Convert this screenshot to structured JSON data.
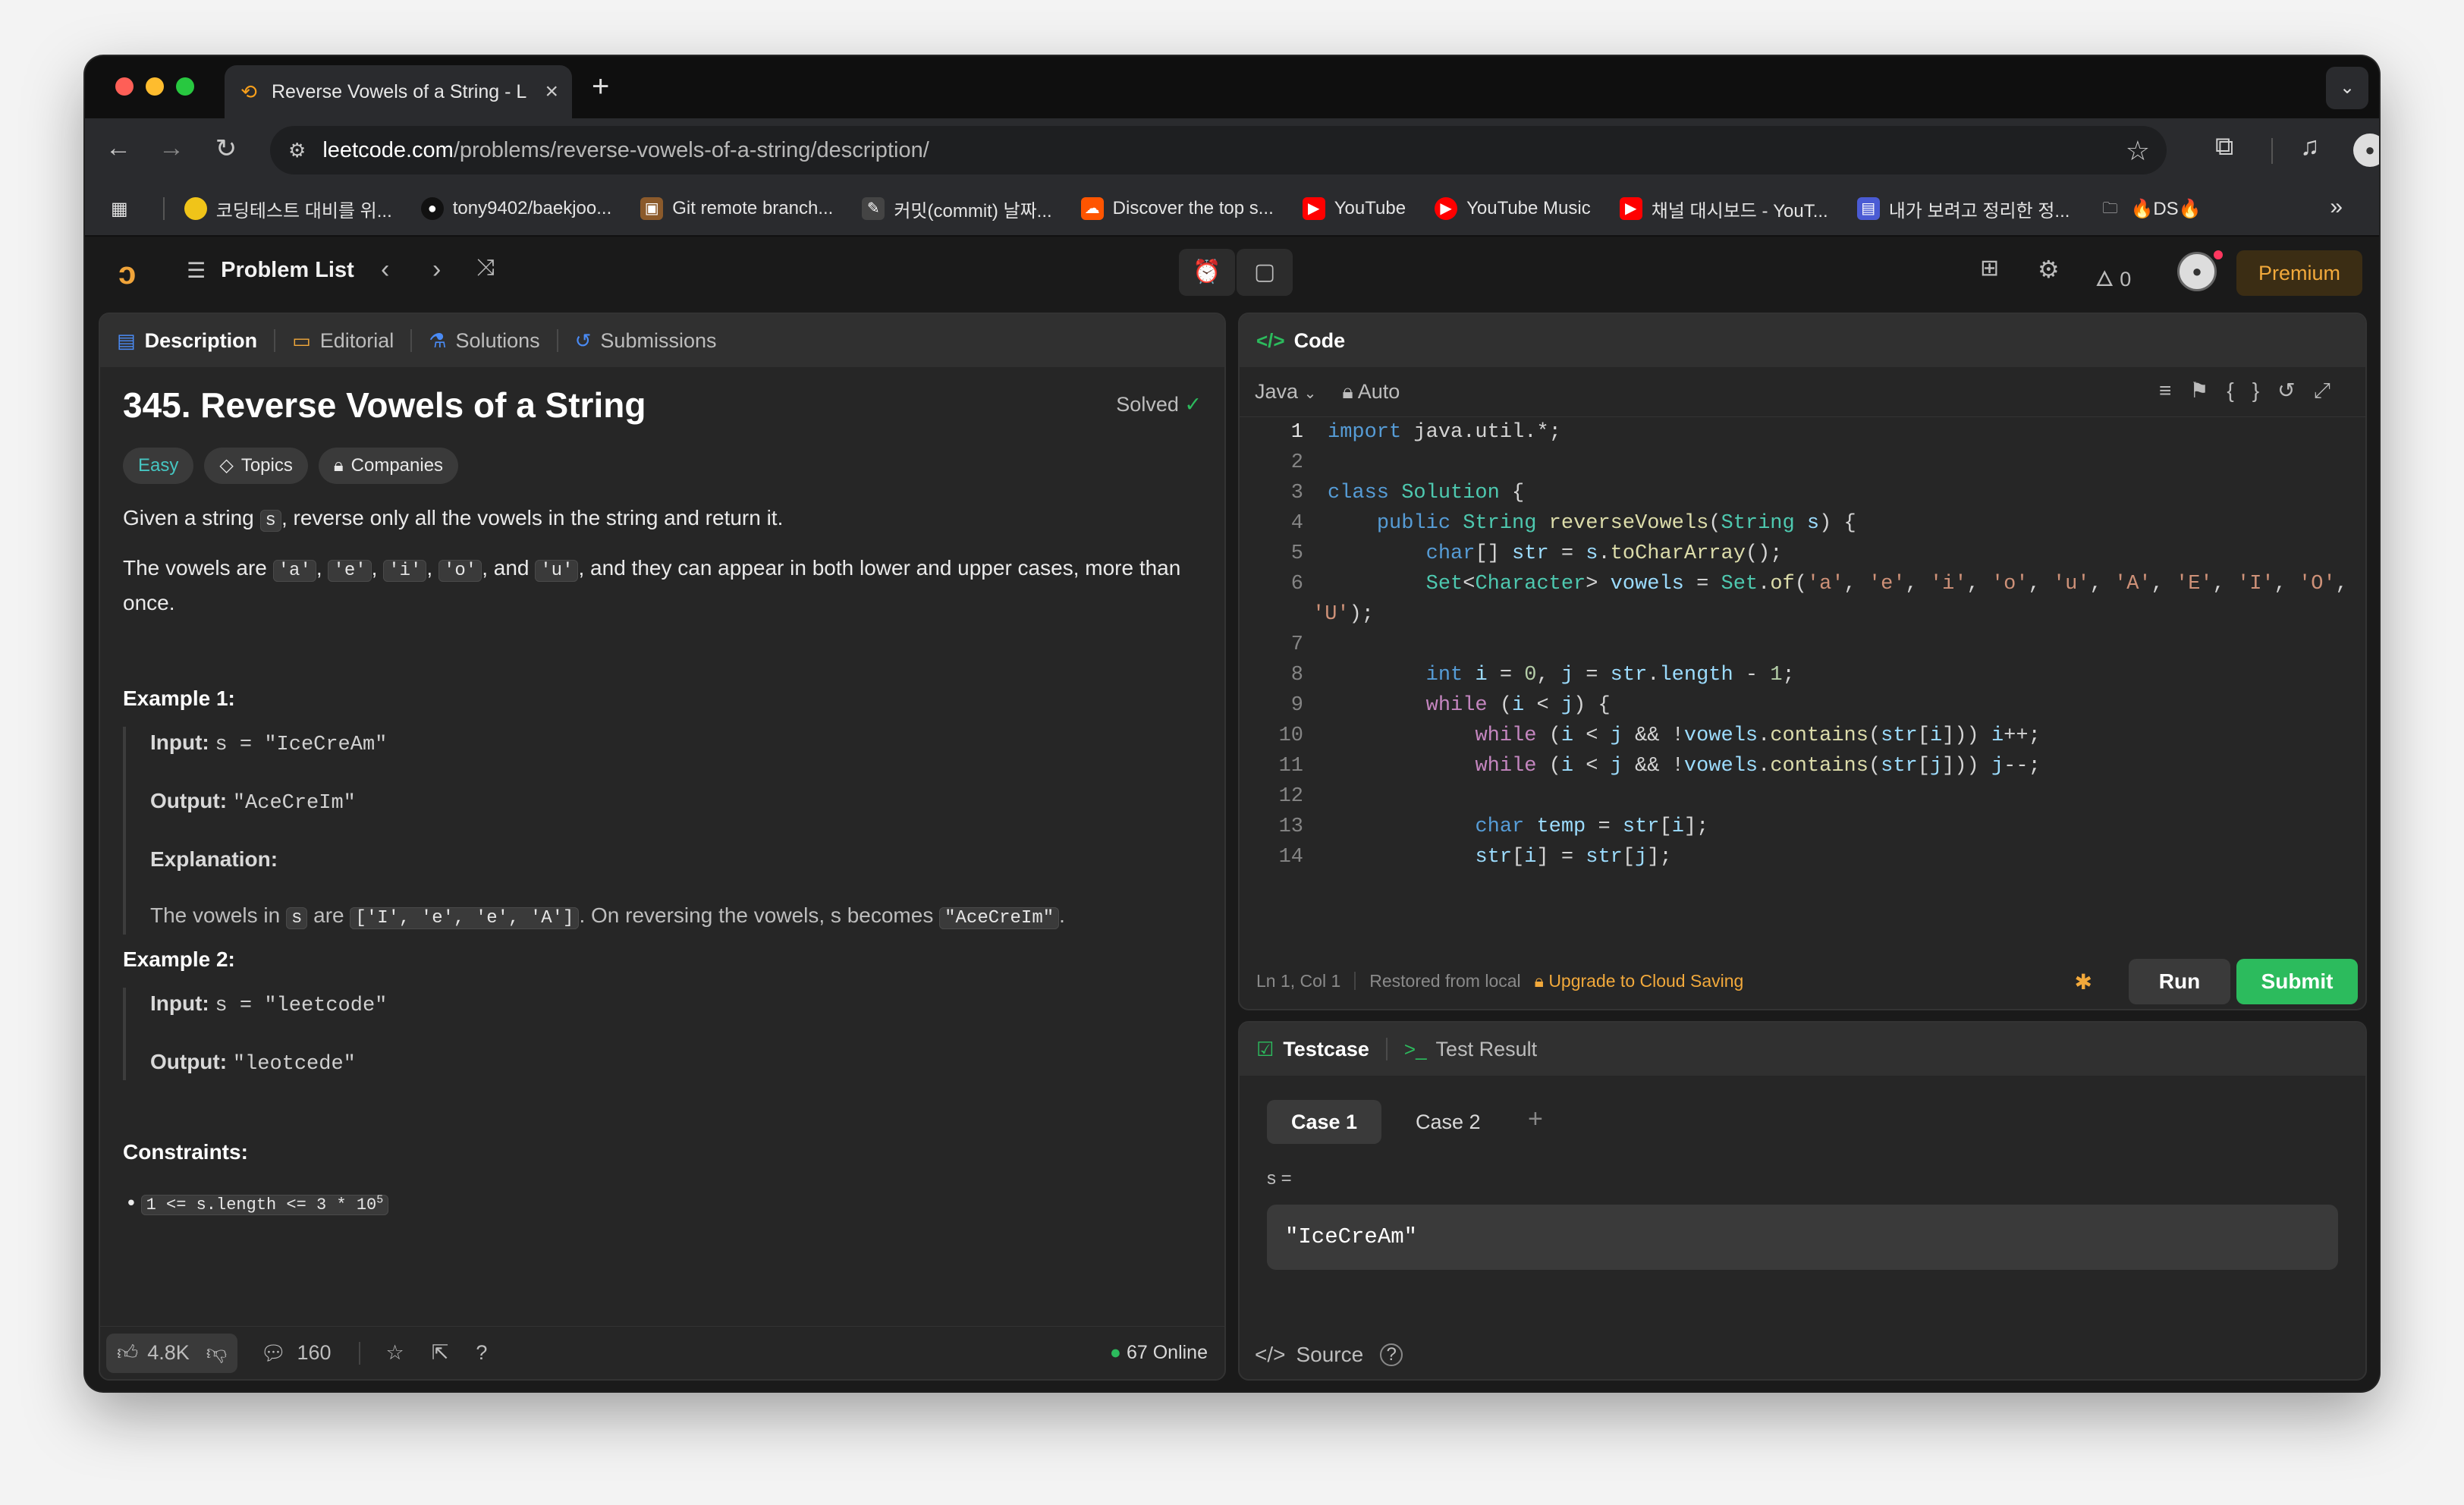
{
  "browser": {
    "tab_title": "Reverse Vowels of a String - L",
    "url_host": "leetcode.com",
    "url_path": "/problems/reverse-vowels-of-a-string/description/",
    "bookmarks": [
      {
        "label": "코딩테스트 대비를 위...",
        "icon": "circle-icon",
        "color": "#f0c419"
      },
      {
        "label": "tony9402/baekjoo...",
        "icon": "github-icon",
        "color": "#111111"
      },
      {
        "label": "Git remote branch...",
        "icon": "page-icon",
        "color": "#8b5a2b"
      },
      {
        "label": "커밋(commit) 날짜...",
        "icon": "page-icon",
        "color": "#444444"
      },
      {
        "label": "Discover the top s...",
        "icon": "soundcloud-icon",
        "color": "#ff5500"
      },
      {
        "label": "YouTube",
        "icon": "youtube-icon",
        "color": "#ff0000"
      },
      {
        "label": "YouTube Music",
        "icon": "youtube-music-icon",
        "color": "#ff0000"
      },
      {
        "label": "채널 대시보드 - YouT...",
        "icon": "youtube-icon",
        "color": "#ff0000"
      },
      {
        "label": "내가 보려고 정리한 정...",
        "icon": "page-icon",
        "color": "#4a5bd4"
      },
      {
        "label": "🔥DS🔥",
        "icon": "folder-icon",
        "color": "#2a2b2e"
      }
    ]
  },
  "header": {
    "problem_list": "Problem List",
    "streak": "0",
    "premium": "Premium"
  },
  "description": {
    "tabs": [
      "Description",
      "Editorial",
      "Solutions",
      "Submissions"
    ],
    "title": "345. Reverse Vowels of a String",
    "status": "Solved",
    "tags": [
      "Easy",
      "Topics",
      "Companies"
    ],
    "p1_a": "Given a string ",
    "p1_code": "s",
    "p1_b": ", reverse only all the vowels in the string and return it.",
    "p2_a": "The vowels are ",
    "vowels": [
      "'a'",
      "'e'",
      "'i'",
      "'o'",
      "'u'"
    ],
    "p2_b": ", and they can appear in both lower and upper cases, more than once.",
    "example1": {
      "heading": "Example 1:",
      "input_label": "Input:",
      "input": "s = \"IceCreAm\"",
      "output_label": "Output:",
      "output": "\"AceCreIm\"",
      "expl_label": "Explanation:",
      "expl_a": "The vowels in ",
      "expl_s": "s",
      "expl_b": " are ",
      "expl_list": "['I', 'e', 'e', 'A']",
      "expl_c": ". On reversing the vowels, s becomes ",
      "expl_res": "\"AceCreIm\"",
      "expl_d": "."
    },
    "example2": {
      "heading": "Example 2:",
      "input_label": "Input:",
      "input": "s = \"leetcode\"",
      "output_label": "Output:",
      "output": "\"leotcede\""
    },
    "constraints_heading": "Constraints:",
    "constraint1": "1 <= s.length <= 3 * 10",
    "constraint1_exp": "5",
    "footer": {
      "likes": "4.8K",
      "comments": "160",
      "online": "67 Online"
    }
  },
  "code": {
    "title": "Code",
    "language": "Java",
    "mode": "Auto",
    "status_pos": "Ln 1, Col 1",
    "status_saved": "Restored from local",
    "upgrade": "Upgrade to Cloud Saving",
    "run": "Run",
    "submit": "Submit"
  },
  "testcase": {
    "tab1": "Testcase",
    "tab2": "Test Result",
    "cases": [
      "Case 1",
      "Case 2"
    ],
    "var_label": "s =",
    "value": "\"IceCreAm\"",
    "source": "Source"
  }
}
